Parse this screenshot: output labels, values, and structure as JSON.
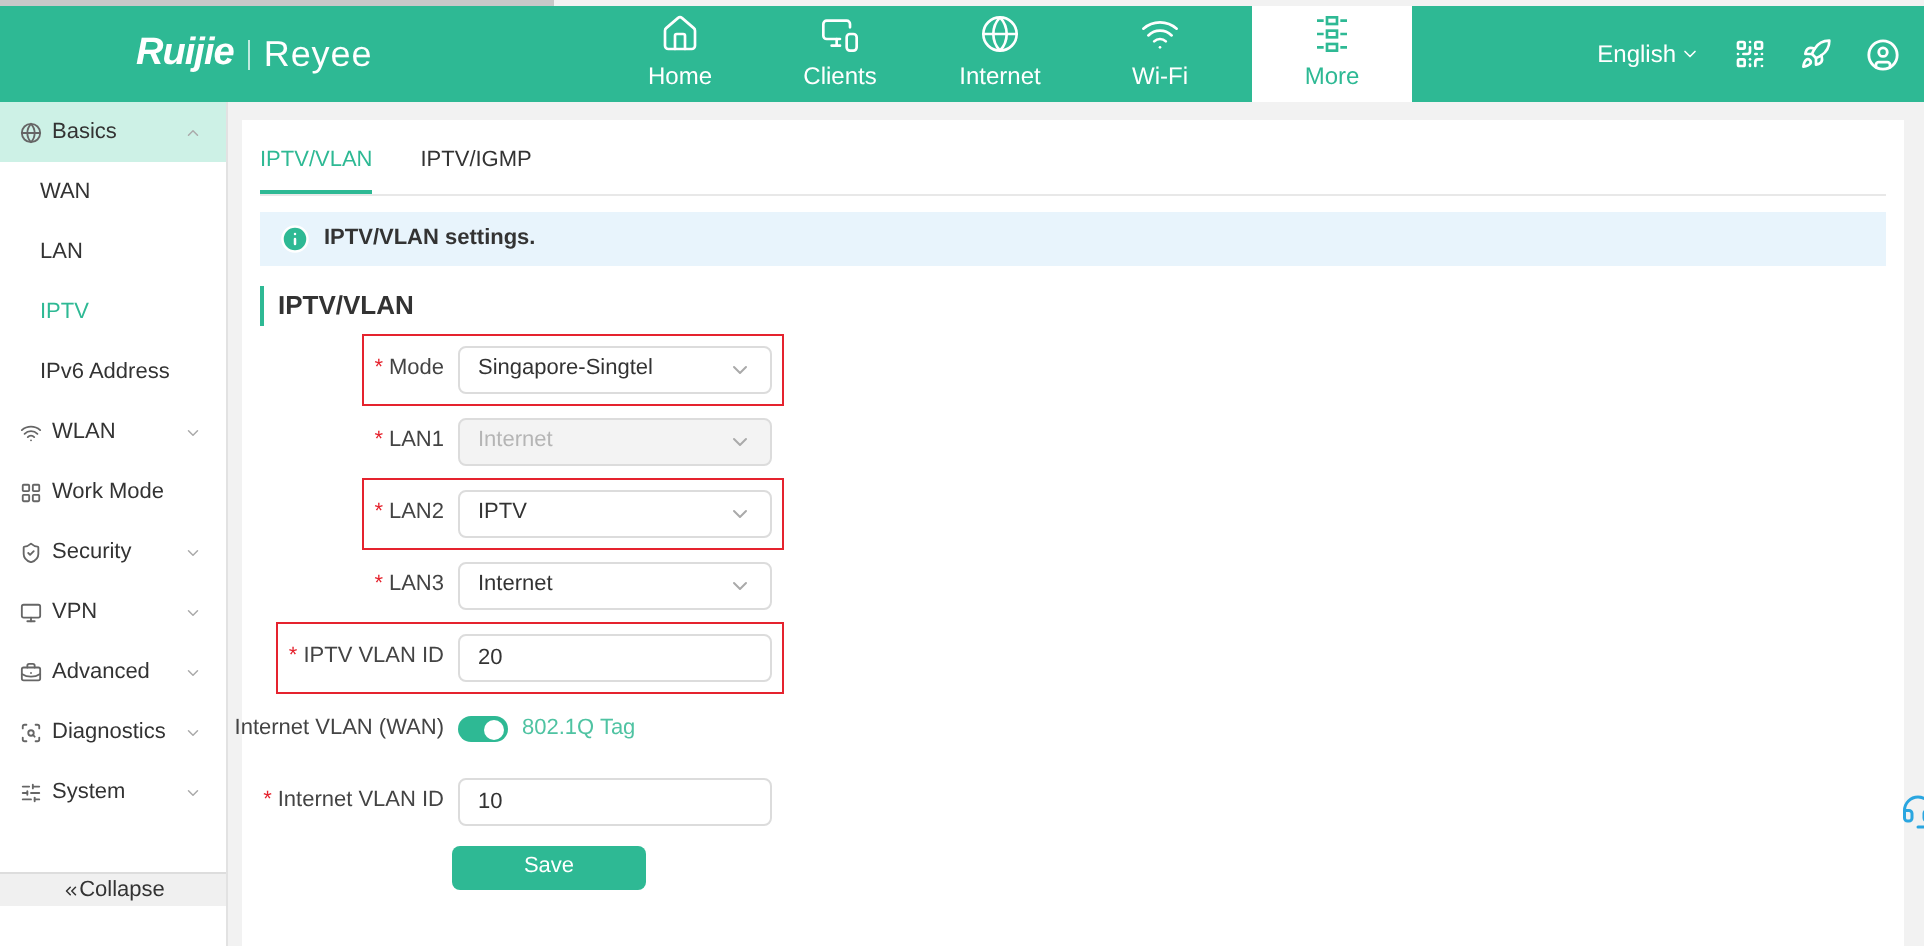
{
  "brand": {
    "logo": "Ruijie",
    "product": "Reyee"
  },
  "nav": [
    {
      "label": "Home",
      "selected": false
    },
    {
      "label": "Clients",
      "selected": false
    },
    {
      "label": "Internet",
      "selected": false
    },
    {
      "label": "Wi-Fi",
      "selected": false
    },
    {
      "label": "More",
      "selected": true
    }
  ],
  "language": "English",
  "sidebar": {
    "items": [
      {
        "label": "Basics",
        "expanded": true,
        "children": [
          {
            "label": "WAN",
            "selected": false
          },
          {
            "label": "LAN",
            "selected": false
          },
          {
            "label": "IPTV",
            "selected": true
          },
          {
            "label": "IPv6 Address",
            "selected": false
          }
        ]
      },
      {
        "label": "WLAN",
        "expanded": false
      },
      {
        "label": "Work Mode"
      },
      {
        "label": "Security",
        "expanded": false
      },
      {
        "label": "VPN",
        "expanded": false
      },
      {
        "label": "Advanced",
        "expanded": false
      },
      {
        "label": "Diagnostics",
        "expanded": false
      },
      {
        "label": "System",
        "expanded": false
      }
    ],
    "collapse": "Collapse"
  },
  "tabs": [
    {
      "label": "IPTV/VLAN",
      "selected": true
    },
    {
      "label": "IPTV/IGMP",
      "selected": false
    }
  ],
  "info": "IPTV/VLAN settings.",
  "section_title": "IPTV/VLAN",
  "form": [
    {
      "kind": "select",
      "label": "Mode",
      "required": true,
      "value": "Singapore-Singtel",
      "disabled": false,
      "highlighted": true
    },
    {
      "kind": "select",
      "label": "LAN1",
      "required": true,
      "value": "Internet",
      "disabled": true,
      "highlighted": false
    },
    {
      "kind": "select",
      "label": "LAN2",
      "required": true,
      "value": "IPTV",
      "disabled": false,
      "highlighted": true
    },
    {
      "kind": "select",
      "label": "LAN3",
      "required": true,
      "value": "Internet",
      "disabled": false,
      "highlighted": false
    },
    {
      "kind": "input",
      "label": "IPTV VLAN ID",
      "required": true,
      "value": "20",
      "highlighted": true
    },
    {
      "kind": "toggle",
      "label": "Internet VLAN (WAN)",
      "required": false,
      "on": true,
      "caption": "802.1Q Tag",
      "highlighted": false
    },
    {
      "kind": "input",
      "label": "Internet VLAN ID",
      "required": true,
      "value": "10",
      "highlighted": false
    }
  ],
  "required_mark": "*",
  "save": "Save"
}
